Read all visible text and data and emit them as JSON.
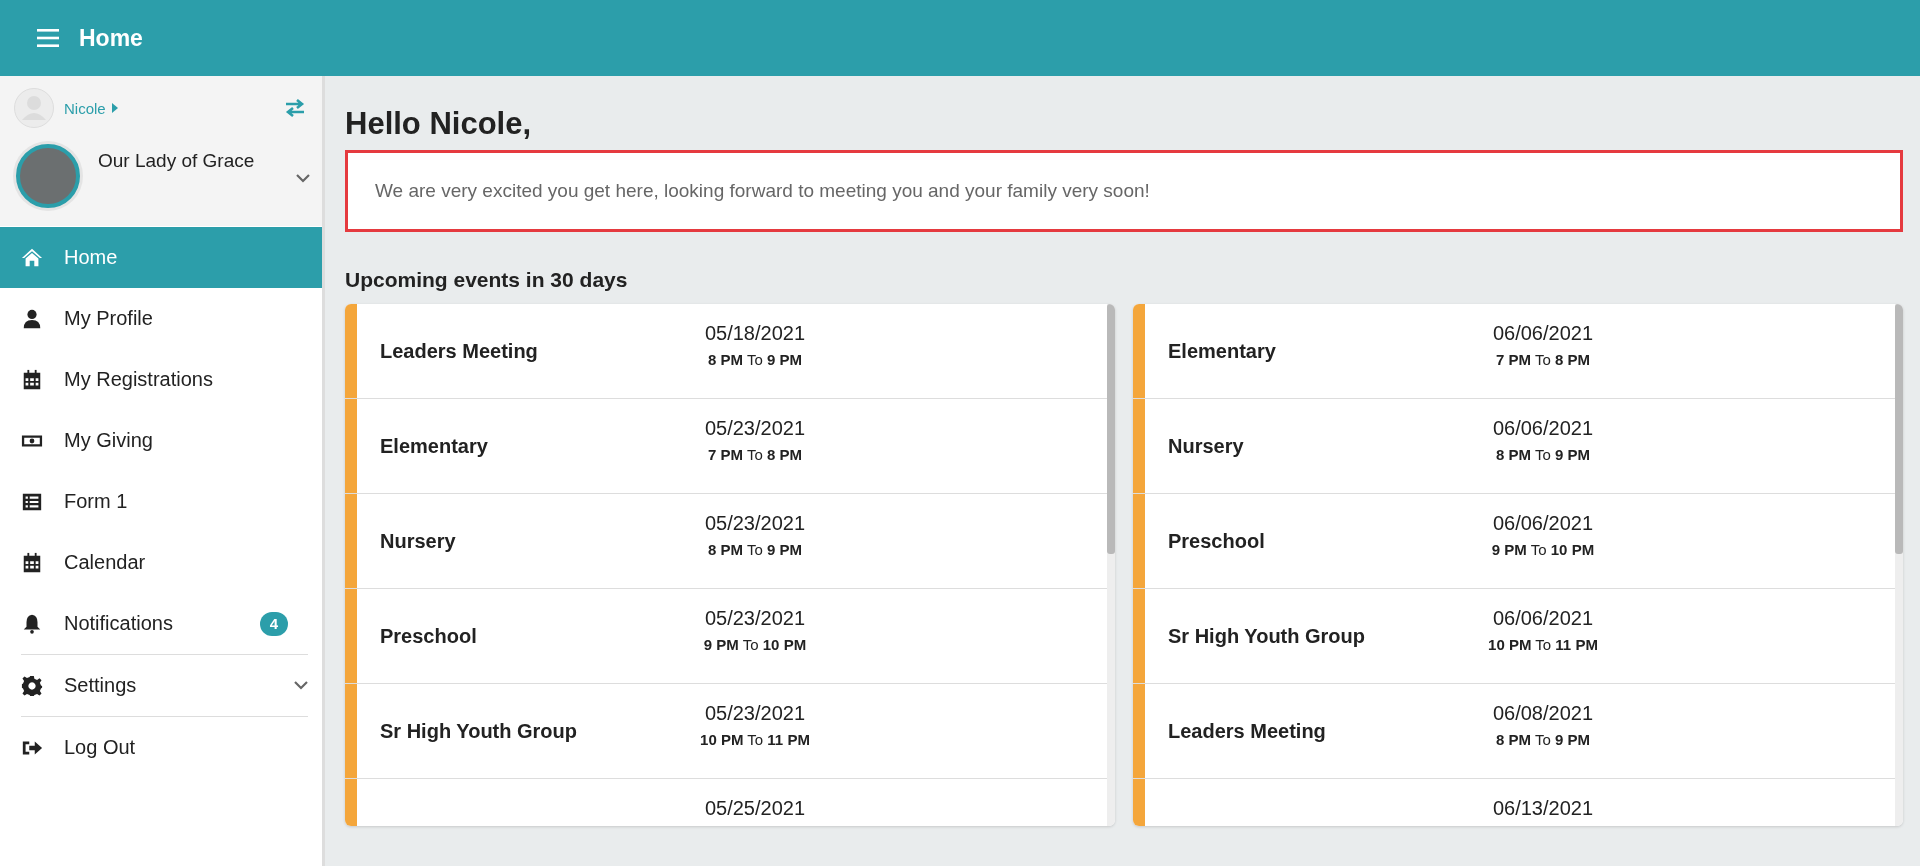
{
  "header": {
    "title": "Home"
  },
  "sidebar": {
    "user": {
      "name": "Nicole"
    },
    "organization": {
      "name": "Our Lady of Grace"
    },
    "menu": [
      {
        "label": "Home",
        "kind": "link",
        "selected": true
      },
      {
        "label": "My Profile",
        "kind": "link",
        "selected": false
      },
      {
        "label": "My Registrations",
        "kind": "link",
        "selected": false
      },
      {
        "label": "My Giving",
        "kind": "link",
        "selected": false
      },
      {
        "label": "Form 1",
        "kind": "link",
        "selected": false
      },
      {
        "label": "Calendar",
        "kind": "link",
        "selected": false
      },
      {
        "label": "Notifications",
        "kind": "link",
        "selected": false,
        "badge": "4"
      },
      {
        "label": "Settings",
        "kind": "group",
        "selected": false,
        "expanded": false
      },
      {
        "label": "Log Out",
        "kind": "link",
        "selected": false
      }
    ]
  },
  "greeting": "Hello Nicole,",
  "message": "We are very excited you get here, looking forward to meeting you and your family very soon!",
  "events": {
    "title": "Upcoming events in 30 days",
    "columns": [
      [
        {
          "name": "Leaders Meeting",
          "date": "05/18/2021",
          "time": "**8 PM** To **9 PM**"
        },
        {
          "name": "Elementary",
          "date": "05/23/2021",
          "time": "**7 PM** To **8 PM**"
        },
        {
          "name": "Nursery",
          "date": "05/23/2021",
          "time": "**8 PM** To **9 PM**"
        },
        {
          "name": "Preschool",
          "date": "05/23/2021",
          "time": "**9 PM** To **10 PM**"
        },
        {
          "name": "Sr High Youth Group",
          "date": "05/23/2021",
          "time": "**10 PM** To **11 PM**"
        },
        {
          "date": "05/25/2021"
        }
      ],
      [
        {
          "name": "Elementary",
          "date": "06/06/2021",
          "time": "**7 PM** To **8 PM**"
        },
        {
          "name": "Nursery",
          "date": "06/06/2021",
          "time": "**8 PM** To **9 PM**"
        },
        {
          "name": "Preschool",
          "date": "06/06/2021",
          "time": "**9 PM** To **10 PM**"
        },
        {
          "name": "Sr High Youth Group",
          "date": "06/06/2021",
          "time": "**10 PM** To **11 PM**"
        },
        {
          "name": "Leaders Meeting",
          "date": "06/08/2021",
          "time": "**8 PM** To **9 PM**"
        },
        {
          "date": "06/13/2021"
        }
      ]
    ]
  }
}
